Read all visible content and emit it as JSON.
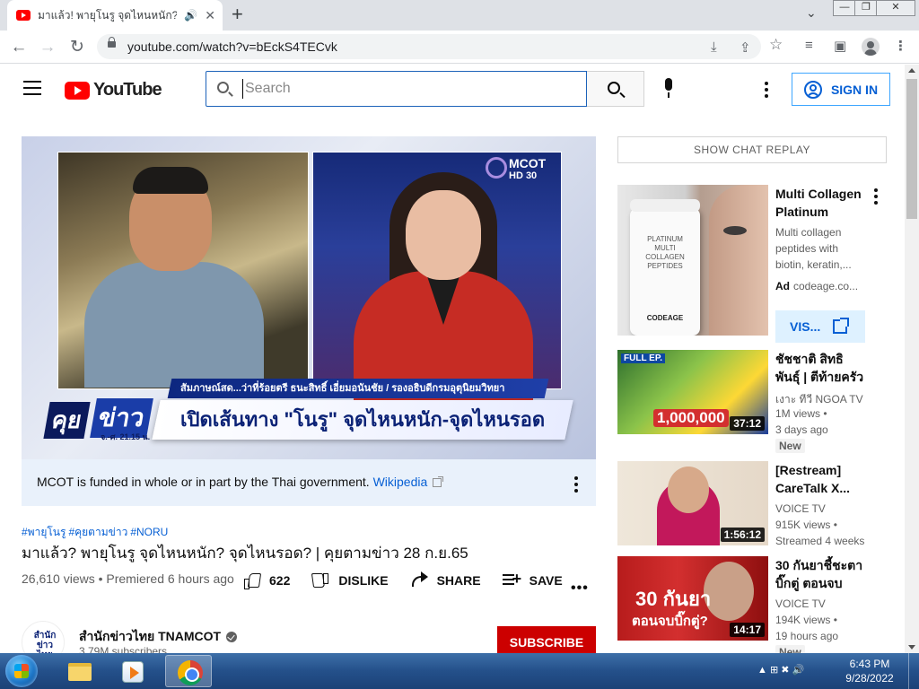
{
  "browser": {
    "tab_title": "มาแล้ว! พายุโนรู จุดไหนหนัก? จุดไหนรอด?",
    "url": "youtube.com/watch?v=bEckS4TECvk",
    "new_tab": "+",
    "close_tab": "✕",
    "back": "←",
    "forward": "→",
    "reload": "↻",
    "install": "⤓",
    "share": "⇪",
    "star": "☆",
    "reading_list": "≡",
    "side_panel": "▣",
    "menu": "⋮",
    "tab_dropdown": "⌄",
    "audio": "🔊",
    "win_min": "—",
    "win_max": "❐",
    "win_close": "✕"
  },
  "youtube": {
    "logo_text": "YouTube",
    "search_placeholder": "Search",
    "sign_in": "SIGN IN"
  },
  "player": {
    "lower_third_top": "สัมภาษณ์สด...ว่าที่ร้อยตรี ธนะสิทธิ์ เอี่ยมอนันชัย / รองอธิบดีกรมอุตุนิยมวิทยา",
    "lower_third_main": "เปิดเส้นทาง \"โนรู\" จุดไหนหนัก-จุดไหนรอด",
    "program_logo_a": "คุย",
    "program_logo_b": "ข่าว",
    "program_logo_sub": "จ.-ศ. 21.15 น.",
    "channel_bug": "MCOT",
    "channel_bug_sub": "HD 30"
  },
  "info_panel": {
    "text": "MCOT is funded in whole or in part by the Thai government.",
    "link": "Wikipedia"
  },
  "video": {
    "hashtags": [
      "#พายุโนรู",
      "#คุยตามข่าว",
      "#NORU"
    ],
    "title": "มาแล้ว? พายุโนรู จุดไหนหนัก? จุดไหนรอด? | คุยตามข่าว 28 ก.ย.65",
    "views_line": "26,610 views • Premiered 6 hours ago",
    "likes": "622",
    "dislike": "DISLIKE",
    "share": "SHARE",
    "save": "SAVE",
    "more": "•••"
  },
  "channel": {
    "name": "สำนักข่าวไทย TNAMCOT",
    "subscribers": "3.79M subscribers",
    "subscribe": "SUBSCRIBE",
    "avatar_text": "สำนักข่าวไทย"
  },
  "sidebar": {
    "chat_replay": "SHOW CHAT REPLAY",
    "ad": {
      "title": "Multi Collagen Platinum",
      "description": "Multi collagen peptides with biotin, keratin,...",
      "ad_label": "Ad",
      "domain": "codeage.co...",
      "visit": "VIS...",
      "bottle_label": "PLATINUM MULTI COLLAGEN PEPTIDES",
      "brand": "CODEAGE"
    },
    "recommendations": [
      {
        "title": "ชัชชาติ สิทธิพันธุ์ | ตีท้ายครัว | 25...",
        "channel": "เงาะ ทีวี NGOA TV",
        "views": "1M views •",
        "age": "3 days ago",
        "badge": "New",
        "duration": "37:12",
        "thumb_text_1": "FULL EP.",
        "thumb_text_2": "1,000,000"
      },
      {
        "title": "[Restream] CareTalk X...",
        "channel": "VOICE TV",
        "views": "915K views •",
        "age": "Streamed 4 weeks",
        "duration": "1:56:12"
      },
      {
        "title": "30 กันยาชี้ชะตา บิ๊กตู่ ตอนจบหรื...",
        "channel": "VOICE TV",
        "views": "194K views •",
        "age": "19 hours ago",
        "badge": "New",
        "duration": "14:17",
        "thumb_text_1": "30 กันยา",
        "thumb_text_2": "ตอนจบบิ๊กตู่?"
      }
    ]
  },
  "taskbar": {
    "time": "6:43 PM",
    "date": "9/28/2022",
    "tray": "▲ ⊞ ✖ 🔊"
  }
}
